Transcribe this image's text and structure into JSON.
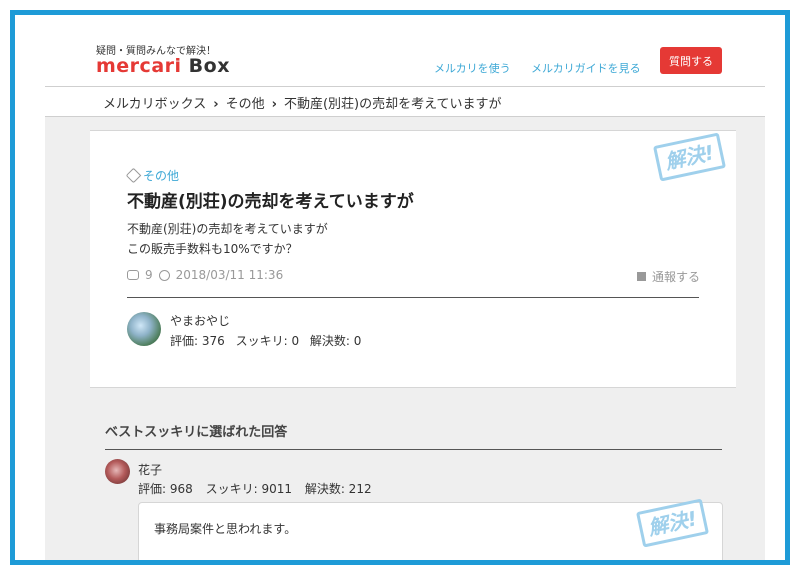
{
  "header": {
    "tagline": "疑問・質問みんなで解決！",
    "logo_part1": "mercari",
    "logo_part2": "Box",
    "nav_use": "メルカリを使う",
    "nav_guide": "メルカリガイドを見る",
    "ask_button": "質問する"
  },
  "breadcrumb": {
    "items": [
      "メルカリボックス",
      "その他",
      "不動産(別荘)の売却を考えていますが"
    ],
    "separator": "›"
  },
  "question": {
    "stamp": "解決!",
    "category": "その他",
    "title": "不動産(別荘)の売却を考えていますが",
    "body_line1": "不動産(別荘)の売却を考えていますが",
    "body_line2": "この販売手数料も10%ですか？",
    "comment_count": "9",
    "datetime": "2018/03/11 11:36",
    "report": "通報する",
    "user": {
      "name": "やまおやじ",
      "rating": "評価: 376",
      "sukkiri": "スッキリ: 0",
      "solved": "解決数: 0"
    }
  },
  "best_answer": {
    "heading": "ベストスッキリに選ばれた回答",
    "stamp": "解決!",
    "user": {
      "name": "花子",
      "rating": "評価: 968",
      "sukkiri": "スッキリ: 9011",
      "solved": "解決数: 212"
    },
    "text": "事務局案件と思われます。"
  },
  "colors": {
    "frame": "#1e9bd7",
    "accent_red": "#e53935",
    "link_blue": "#3fa9d6",
    "stamp_blue": "#9fd0ec",
    "page_gray": "#efefef"
  },
  "icons": [
    "tag-icon",
    "comment-icon",
    "clock-icon",
    "flag-icon",
    "chevron-right-icon"
  ]
}
